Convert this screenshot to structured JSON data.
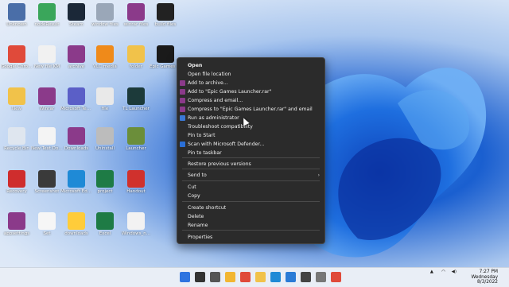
{
  "colors": {
    "menu_bg": "#2b2b2b",
    "taskbar_bg": "#e9eef6",
    "wallpaper_accent": "#1a5fd0"
  },
  "desktop": {
    "icons": [
      {
        "label": "Unknown",
        "color": "#4a6ea8",
        "icon": "app-icon"
      },
      {
        "label": "nodeResult",
        "color": "#3aa65b",
        "icon": "file-icon"
      },
      {
        "label": "Steam",
        "color": "#1b2838",
        "icon": "steam-icon"
      },
      {
        "label": "window files",
        "color": "#9aa7b8",
        "icon": "file-icon"
      },
      {
        "label": "winrar files",
        "color": "#8b3a8a",
        "icon": "archive-icon"
      },
      {
        "label": "build files",
        "color": "#222",
        "icon": "terminal-icon"
      },
      {
        "label": "Google Chrome",
        "color": "#e04a3a",
        "icon": "chrome-icon"
      },
      {
        "label": "New file KM",
        "color": "#f1f1f1",
        "icon": "document-icon"
      },
      {
        "label": "archive",
        "color": "#8b3a8a",
        "icon": "archive-icon"
      },
      {
        "label": "VLC media",
        "color": "#ef8a1a",
        "icon": "vlc-icon"
      },
      {
        "label": "folder",
        "color": "#f1c24a",
        "icon": "folder-icon"
      },
      {
        "label": "Epic Games Launcher",
        "color": "#1a1a1a",
        "icon": "epic-games-icon"
      },
      {
        "label": "New",
        "color": "#f1c24a",
        "icon": "folder-icon"
      },
      {
        "label": "Winrar",
        "color": "#8b3a8a",
        "icon": "archive-icon"
      },
      {
        "label": "Microsoft Teams",
        "color": "#5b5fc7",
        "icon": "teams-icon"
      },
      {
        "label": "file",
        "color": "#e9e9e9",
        "icon": "settings-icon"
      },
      {
        "label": "TL Launcher",
        "color": "#1c3a3a",
        "icon": "tl-icon"
      },
      {
        "label": "Recycle Bin",
        "color": "#dfe6ef",
        "icon": "recycle-bin-icon"
      },
      {
        "label": "New Text Document",
        "color": "#f4f4f4",
        "icon": "document-icon"
      },
      {
        "label": "Downloads",
        "color": "#8b3a8a",
        "icon": "archive-icon"
      },
      {
        "label": "Uninstall",
        "color": "#bcbcbc",
        "icon": "app-icon"
      },
      {
        "label": "Launcher",
        "color": "#6b8e3a",
        "icon": "minecraft-icon"
      },
      {
        "label": "Recovery",
        "color": "#cf2d2d",
        "icon": "app-icon"
      },
      {
        "label": "Screenshot",
        "color": "#3a3a3a",
        "icon": "image-icon"
      },
      {
        "label": "Microsoft Edge",
        "color": "#1f8ad6",
        "icon": "edge-icon"
      },
      {
        "label": "project",
        "color": "#1e7b45",
        "icon": "excel-icon"
      },
      {
        "label": "Handout",
        "color": "#d0312d",
        "icon": "pdf-icon"
      },
      {
        "label": "appsettings",
        "color": "#8b3a8a",
        "icon": "archive-icon"
      },
      {
        "label": "Set",
        "color": "#f6f6f6",
        "icon": "document-icon"
      },
      {
        "label": "downloads",
        "color": "#ffcc3a",
        "icon": "app-icon"
      },
      {
        "label": "Excel",
        "color": "#1e7b45",
        "icon": "excel-icon"
      },
      {
        "label": "Windows_n...",
        "color": "#f2f2f2",
        "icon": "document-icon"
      }
    ]
  },
  "context_menu": {
    "items": [
      {
        "label": "Open",
        "bold": true,
        "icon": ""
      },
      {
        "label": "Open file location",
        "icon": ""
      },
      {
        "label": "Add to archive...",
        "icon": "winrar-icon"
      },
      {
        "label": "Add to \"Epic Games Launcher.rar\"",
        "icon": "winrar-icon"
      },
      {
        "label": "Compress and email...",
        "icon": "winrar-icon"
      },
      {
        "label": "Compress to \"Epic Games Launcher.rar\" and email",
        "icon": "winrar-icon"
      },
      {
        "label": "Run as administrator",
        "icon": "shield-icon"
      },
      {
        "label": "Troubleshoot compatibility",
        "icon": ""
      },
      {
        "label": "Pin to Start",
        "icon": ""
      },
      {
        "label": "Scan with Microsoft Defender...",
        "icon": "defender-icon"
      },
      {
        "label": "Pin to taskbar",
        "icon": ""
      },
      {
        "label": "Restore previous versions",
        "icon": ""
      },
      {
        "label": "Send to",
        "icon": "",
        "submenu": true
      },
      {
        "label": "Cut",
        "icon": ""
      },
      {
        "label": "Copy",
        "icon": ""
      },
      {
        "label": "Create shortcut",
        "icon": ""
      },
      {
        "label": "Delete",
        "icon": ""
      },
      {
        "label": "Rename",
        "icon": ""
      },
      {
        "label": "Properties",
        "icon": ""
      }
    ],
    "chevron": "›"
  },
  "taskbar": {
    "time": "7:27 PM",
    "day": "Wednesday",
    "date": "8/3/2022",
    "pinned": [
      "windows-start-icon",
      "search-icon",
      "task-view-icon",
      "file-explorer-icon",
      "chrome-icon",
      "folder-icon",
      "edge-icon",
      "vscode-icon",
      "monitor-icon",
      "settings-icon",
      "chrome-icon"
    ]
  }
}
